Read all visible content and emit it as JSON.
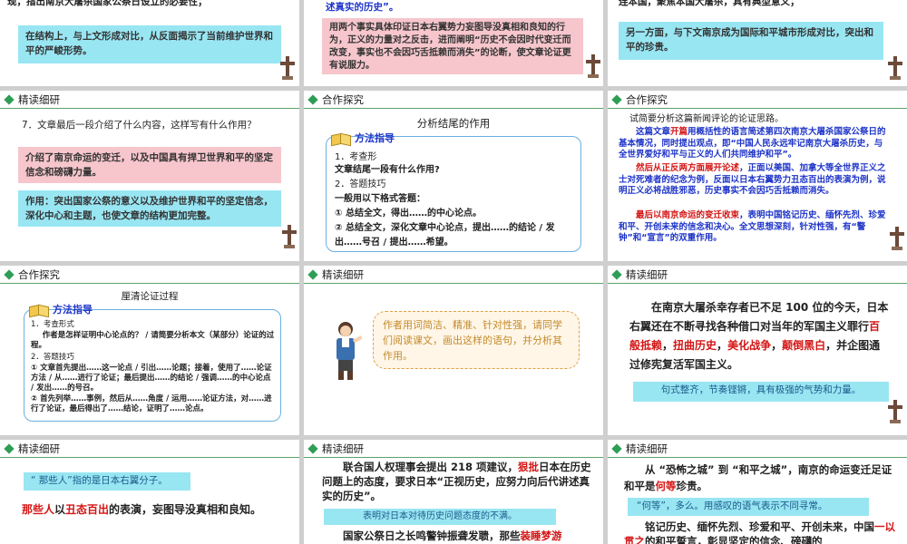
{
  "slides": {
    "s1": {
      "top_text": "现，指出南京大屠杀国家公祭日设立的必要性；",
      "cyan_text": "在结构上，与上文形成对比，从反面揭示了当前维护世界和平的严峻形势。"
    },
    "s2": {
      "top_text": "述真实的历史”。",
      "pink_text": "用两个事实具体印证日本右翼势力妄图导没真相和良知的行为，正义的力量对之反击，进而阐明“历史不会因时代变迁而改变，事实也不会因巧舌抵赖而消失”的论断，使文章论证更有说服力。"
    },
    "s3": {
      "top_text": "连本国，聚焦本国大屠杀，具有典型意义；",
      "cyan_text": "另一方面，与下文南京成为国际和平城市形成对比，突出和平的珍贵。"
    },
    "s4": {
      "header": "精读细研",
      "question": "7．文章最后一段介绍了什么内容，这样写有什么作用？",
      "pink_text": "介绍了南京命运的变迁，以及中国具有捍卫世界和平的坚定信念和磅礴力量。",
      "cyan_text": "作用：突出国家公祭的意义以及维护世界和平的坚定信念，深化中心和主题，也使文章的结构更加完整。"
    },
    "s5": {
      "header": "合作探究",
      "title": "分析结尾的作用",
      "method_label": "方法指导",
      "lines": [
        "1．考查形",
        "文章结尾一段有什么作用?",
        "2．答题技巧",
        "一般用以下格式答题：",
        "① 总结全文，得出……的中心论点。",
        "② 总结全文，深化文章中心论点，提出……的结论 / 发出……号召 / 提出……希望。"
      ]
    },
    "s6": {
      "header": "合作探究",
      "question": "试简要分析这篇新闻评论的论证思路。",
      "p1_prefix": "这篇文章",
      "p1_red": "开篇",
      "p1_rest": "用概括性的语言简述第四次南京大屠杀国家公祭日的基本情况，同时提出观点，即“中国人民永远牢记南京大屠杀历史，与全世界爱好和平与正义的人们共同维护和平”。",
      "p2_red": "然后从正反两方面展开论述",
      "p2_rest": "，正面以美国、加拿大等全世界正义之士对死难者的纪念为例，反面以日本右翼势力丑态百出的表演为例，说明正义必将战胜邪恶，历史事实不会因巧舌抵赖而消失。",
      "p3_red": "最后以南京命运的变迁收束",
      "p3_rest": "，表明中国铭记历史、缅怀先烈、珍爱和平、开创未来的信念和决心。全文思想深刻，针对性强，有“警钟”和“宣言”的双重作用。"
    },
    "s7": {
      "header": "合作探究",
      "title": "厘清论证过程",
      "method_label": "方法指导",
      "lines": [
        "1．考查形式",
        "作者是怎样证明中心论点的？ / 请简要分析本文（某部分）论证的过程。",
        "2．答题技巧",
        "① 文章首先提出……这一论点 / 引出……论题；接着，使用了……论证方法 / 从……进行了论证；最后提出……的结论 / 强调……的中心论点 / 发出……的号召。",
        "② 首先列举……事例，然后从……角度 / 运用……论证方法，对……进行了论证，最后得出了……结论，证明了……论点。"
      ]
    },
    "s8": {
      "header": "精读细研",
      "bubble": "作者用词简洁、精准、针对性强，请同学们阅读课文，画出这样的语句，并分析其作用。"
    },
    "s9": {
      "header": "精读细研",
      "t1": "在南京大屠杀幸存者已不足 100 位的今天，日本右翼还在不断寻找各种借口对当年的军国主义罪行",
      "r1": "百般抵赖",
      "sep1": "，",
      "r2": "扭曲历史",
      "sep2": "，",
      "r3": "美化战争",
      "sep3": "，",
      "r4": "颠倒黑白",
      "t2": "，并企图通过修宪复活军国主义。",
      "note": "句式整齐，节奏铿锵，具有极强的气势和力量。"
    },
    "s10": {
      "header": "精读细研",
      "note": "“ 那些人”指的是日本右翼分子。",
      "r1": "那些人",
      "t1": "以",
      "r2": "丑态百出",
      "t2": "的表演，妄图导没真相和良知。"
    },
    "s11": {
      "header": "精读细研",
      "t1": "联合国人权理事会提出 218 项建议，",
      "r1": "狠批",
      "t2": "日本在历史问题上的态度，要求日本“正视历史，应努力向后代讲述真实的历史”。",
      "note": "表明对日本对待历史问题态度的不满。",
      "t3": "国家公祭日之长鸣警钟振聋发聩，那些",
      "r2": "装睡梦游"
    },
    "s12": {
      "header": "精读细研",
      "t1": "从 “恐怖之城” 到 “和平之城”，南京的命运变迁足证和平是",
      "r1": "何等",
      "t2": "珍贵。",
      "note": "“何等”，多么。用感叹的语气表示不同寻常。",
      "t3": "铭记历史、缅怀先烈、珍爱和平、开创未来，中国",
      "r2": "一以贯之",
      "t4": "的和平誓言，彰显坚定的信念、磅礴的"
    }
  },
  "colors": {
    "pink": "#f6c6cc",
    "cyan": "#99e6f3",
    "red": "#d41414",
    "blue": "#1e34c8",
    "green": "#2e9e56"
  }
}
